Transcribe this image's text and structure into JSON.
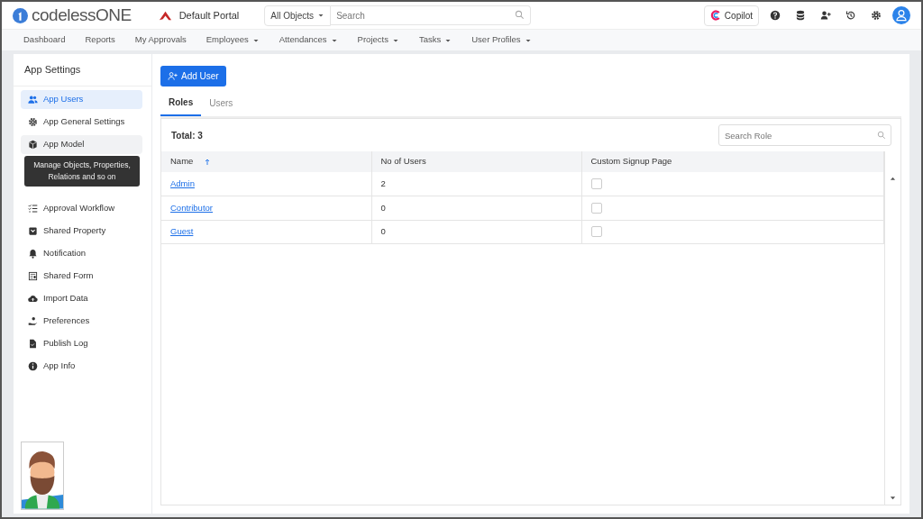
{
  "header": {
    "logo": "codelessONE",
    "portal": "Default Portal",
    "search_scope": "All Objects",
    "search": {
      "placeholder": "Search"
    },
    "copilot": "Copilot"
  },
  "nav": [
    {
      "label": "Dashboard",
      "dropdown": false
    },
    {
      "label": "Reports",
      "dropdown": false
    },
    {
      "label": "My Approvals",
      "dropdown": false
    },
    {
      "label": "Employees",
      "dropdown": true
    },
    {
      "label": "Attendances",
      "dropdown": true
    },
    {
      "label": "Projects",
      "dropdown": true
    },
    {
      "label": "Tasks",
      "dropdown": true
    },
    {
      "label": "User Profiles",
      "dropdown": true
    }
  ],
  "sidebar": {
    "title": "App Settings",
    "items": [
      {
        "label": "App Users",
        "selected": true,
        "hovered": false
      },
      {
        "label": "App General Settings",
        "selected": false,
        "hovered": false
      },
      {
        "label": "App Model",
        "selected": false,
        "hovered": true
      },
      {
        "label": "Approval Workflow",
        "selected": false,
        "hovered": false
      },
      {
        "label": "Shared Property",
        "selected": false,
        "hovered": false
      },
      {
        "label": "Notification",
        "selected": false,
        "hovered": false
      },
      {
        "label": "Shared Form",
        "selected": false,
        "hovered": false
      },
      {
        "label": "Import Data",
        "selected": false,
        "hovered": false
      },
      {
        "label": "Preferences",
        "selected": false,
        "hovered": false
      },
      {
        "label": "Publish Log",
        "selected": false,
        "hovered": false
      },
      {
        "label": "App Info",
        "selected": false,
        "hovered": false
      }
    ],
    "tooltip": "Manage Objects, Properties, Relations and so on"
  },
  "main": {
    "add_button": "Add User",
    "tabs": [
      {
        "label": "Roles",
        "selected": true
      },
      {
        "label": "Users",
        "selected": false
      }
    ],
    "total": "Total: 3",
    "search": {
      "placeholder": "Search Role"
    },
    "table": {
      "columns": [
        "Name",
        "No of Users",
        "Custom Signup Page"
      ],
      "rows": [
        {
          "name": "Admin",
          "users": "2",
          "custom_signup": false
        },
        {
          "name": "Contributor",
          "users": "0",
          "custom_signup": false
        },
        {
          "name": "Guest",
          "users": "0",
          "custom_signup": false
        }
      ]
    }
  }
}
